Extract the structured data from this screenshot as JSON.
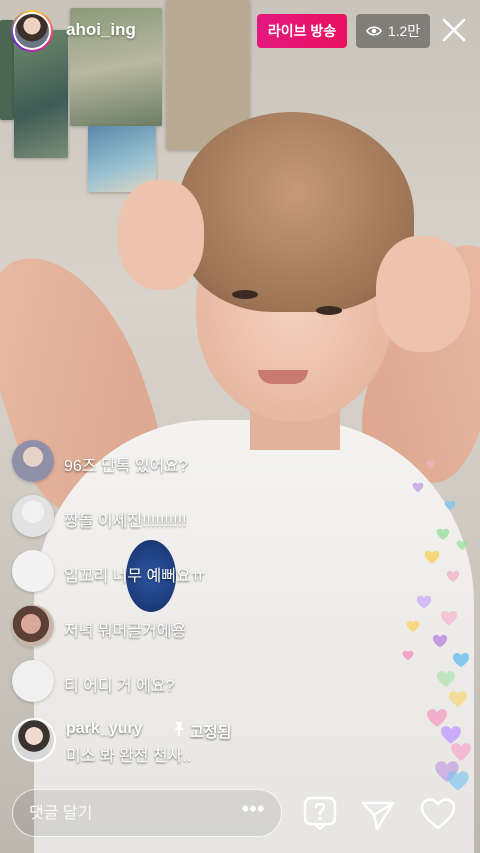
{
  "header": {
    "username": "ahoi_ing",
    "live_label": "라이브 방송",
    "viewer_count": "1.2만"
  },
  "comments": [
    {
      "user": "",
      "text": "96즈 단톡 있어요?"
    },
    {
      "user": "",
      "text": "짱돌 이세진!!!!!!!!!!"
    },
    {
      "user": "",
      "text": "입꼬리 너무 예뻐요ㅠ"
    },
    {
      "user": "",
      "text": "저녁 뭐머글거에용"
    },
    {
      "user": "",
      "text": "티 어디 거 에요?"
    }
  ],
  "pinned_comment": {
    "user": "park_yury",
    "pin_label": "고정됨",
    "text": "미소 봐 완전 천사.."
  },
  "bottom_bar": {
    "comment_placeholder": "댓글 달기",
    "more_label": "•••"
  },
  "colors": {
    "live_badge": "#e6187f",
    "hearts": [
      "#f7b6d2",
      "#b78be0",
      "#7bc6f0",
      "#9ee0a0",
      "#f8d56b",
      "#f49ac1",
      "#c2a0ff"
    ]
  },
  "icons": {
    "close": "close-icon",
    "eye": "eye-icon",
    "pin": "pin-icon",
    "question": "question-box-icon",
    "send": "paper-plane-icon",
    "like": "heart-outline-icon"
  }
}
